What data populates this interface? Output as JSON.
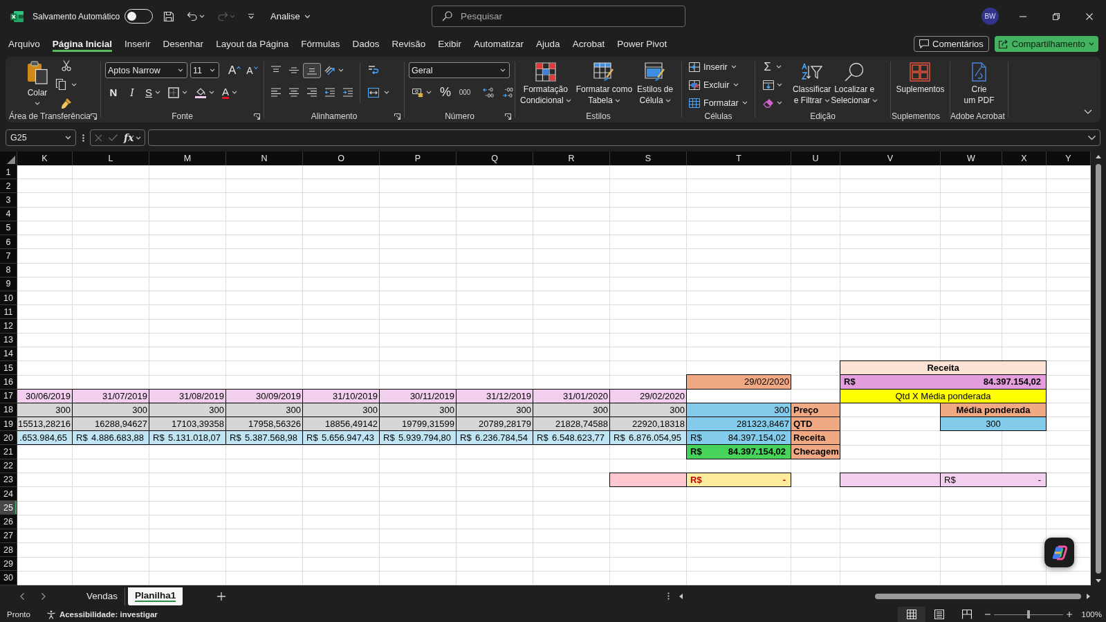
{
  "title_bar": {
    "autosave_label": "Salvamento Automático",
    "autosave_on": false,
    "quick_access": [
      {
        "kind": "save",
        "disabled": false
      },
      {
        "kind": "undo",
        "disabled": false
      },
      {
        "kind": "redo",
        "disabled": true
      },
      {
        "kind": "customize",
        "disabled": false
      }
    ],
    "file_name": "Analise",
    "search": {
      "placeholder": "Pesquisar"
    },
    "user_initials": "BW"
  },
  "menu_tabs": [
    {
      "label": "Arquivo",
      "selected": false
    },
    {
      "label": "Página Inicial",
      "selected": true
    },
    {
      "label": "Inserir",
      "selected": false
    },
    {
      "label": "Desenhar",
      "selected": false
    },
    {
      "label": "Layout da Página",
      "selected": false
    },
    {
      "label": "Fórmulas",
      "selected": false
    },
    {
      "label": "Dados",
      "selected": false
    },
    {
      "label": "Revisão",
      "selected": false
    },
    {
      "label": "Exibir",
      "selected": false
    },
    {
      "label": "Automatizar",
      "selected": false
    },
    {
      "label": "Ajuda",
      "selected": false
    },
    {
      "label": "Acrobat",
      "selected": false
    },
    {
      "label": "Power Pivot",
      "selected": false
    }
  ],
  "comments_button": "Comentários",
  "share_button": "Compartilhamento",
  "ribbon": {
    "clipboard": {
      "paste_label": "Colar",
      "group_label": "Área de Transferência"
    },
    "font": {
      "font_name": "Aptos Narrow",
      "font_size": "11",
      "grow_letter": "A",
      "shrink_letter": "A",
      "bold_letter": "N",
      "italic_letter": "I",
      "underline_letter": "S",
      "color_letter": "A",
      "group_label": "Fonte"
    },
    "alignment": {
      "vertical": [
        {
          "kind": "top",
          "selected": false
        },
        {
          "kind": "middle",
          "selected": false
        },
        {
          "kind": "bottom",
          "selected": true
        }
      ],
      "horizontal": [
        {
          "kind": "left",
          "selected": false
        },
        {
          "kind": "center",
          "selected": false
        },
        {
          "kind": "right",
          "selected": false
        }
      ],
      "group_label": "Alinhamento"
    },
    "number": {
      "format": "Geral",
      "percent_sign": "%",
      "thousands_sign": "000",
      "group_label": "Número"
    },
    "styles": {
      "buttons": [
        {
          "kind": "conditional",
          "label": "Formatação\nCondicional"
        },
        {
          "kind": "table",
          "label": "Formatar como\nTabela"
        },
        {
          "kind": "cell_styles",
          "label": "Estilos de\nCélula"
        }
      ],
      "group_label": "Estilos"
    },
    "cells": {
      "buttons": [
        {
          "kind": "insert",
          "label": "Inserir"
        },
        {
          "kind": "delete",
          "label": "Excluir"
        },
        {
          "kind": "format",
          "label": "Formatar"
        }
      ],
      "group_label": "Células"
    },
    "editing": {
      "sum_sign": "Σ",
      "buttons": [
        {
          "kind": "sort",
          "label": "Classificar\ne Filtrar"
        },
        {
          "kind": "find",
          "label": "Localizar e\nSelecionar"
        }
      ],
      "group_label": "Edição"
    },
    "addins": {
      "label": "Suplementos",
      "group_label": "Suplementos"
    },
    "acrobat": {
      "label": "Crie\num PDF",
      "group_label": "Adobe Acrobat"
    }
  },
  "formula_bar": {
    "name_box": "G25",
    "entry_disabled": true,
    "function_sign": "fx"
  },
  "sheet": {
    "columns": [
      "K",
      "L",
      "M",
      "N",
      "O",
      "P",
      "Q",
      "R",
      "S",
      "T",
      "U",
      "V",
      "W",
      "X",
      "Y"
    ],
    "rows": [
      {
        "label": "1",
        "selected": false
      },
      {
        "label": "2",
        "selected": false
      },
      {
        "label": "3",
        "selected": false
      },
      {
        "label": "4",
        "selected": false
      },
      {
        "label": "5",
        "selected": false
      },
      {
        "label": "6",
        "selected": false
      },
      {
        "label": "7",
        "selected": false
      },
      {
        "label": "8",
        "selected": false
      },
      {
        "label": "9",
        "selected": false
      },
      {
        "label": "10",
        "selected": false
      },
      {
        "label": "11",
        "selected": false
      },
      {
        "label": "12",
        "selected": false
      },
      {
        "label": "13",
        "selected": false
      },
      {
        "label": "14",
        "selected": false
      },
      {
        "label": "15",
        "selected": false,
        "cells": [
          {
            "kind": "empty"
          },
          {
            "kind": "empty"
          },
          {
            "kind": "empty"
          },
          {
            "kind": "empty"
          },
          {
            "kind": "empty"
          },
          {
            "kind": "empty"
          },
          {
            "kind": "empty"
          },
          {
            "kind": "empty"
          },
          {
            "kind": "empty"
          },
          {
            "kind": "empty"
          },
          {
            "kind": "empty"
          },
          {
            "kind": "centered",
            "text": "Receita",
            "bold": true,
            "alert": false,
            "color": "#fbe2d5"
          },
          {
            "kind": "merged"
          },
          {
            "kind": "merged"
          },
          {
            "kind": "empty"
          }
        ]
      },
      {
        "label": "16",
        "selected": false,
        "cells": [
          {
            "kind": "empty"
          },
          {
            "kind": "empty"
          },
          {
            "kind": "empty"
          },
          {
            "kind": "empty"
          },
          {
            "kind": "empty"
          },
          {
            "kind": "empty"
          },
          {
            "kind": "empty"
          },
          {
            "kind": "empty"
          },
          {
            "kind": "empty"
          },
          {
            "kind": "number",
            "text": "29/02/2020",
            "bold": false,
            "alert": false,
            "color": "#f1a983"
          },
          {
            "kind": "empty"
          },
          {
            "kind": "currency",
            "prefix": "R$",
            "text": "84.397.154,02",
            "bold": true,
            "alert": false,
            "color": "#e59edd"
          },
          {
            "kind": "merged"
          },
          {
            "kind": "merged"
          },
          {
            "kind": "empty"
          }
        ]
      },
      {
        "label": "17",
        "selected": false,
        "cells": [
          {
            "kind": "number",
            "text": "30/06/2019",
            "bold": false,
            "alert": false,
            "color": "#f2ceef"
          },
          {
            "kind": "number",
            "text": "31/07/2019",
            "bold": false,
            "alert": false,
            "color": "#f2ceef"
          },
          {
            "kind": "number",
            "text": "31/08/2019",
            "bold": false,
            "alert": false,
            "color": "#f2ceef"
          },
          {
            "kind": "number",
            "text": "30/09/2019",
            "bold": false,
            "alert": false,
            "color": "#f2ceef"
          },
          {
            "kind": "number",
            "text": "31/10/2019",
            "bold": false,
            "alert": false,
            "color": "#f2ceef"
          },
          {
            "kind": "number",
            "text": "30/11/2019",
            "bold": false,
            "alert": false,
            "color": "#f2ceef"
          },
          {
            "kind": "number",
            "text": "31/12/2019",
            "bold": false,
            "alert": false,
            "color": "#f2ceef"
          },
          {
            "kind": "number",
            "text": "31/01/2020",
            "bold": false,
            "alert": false,
            "color": "#f2ceef"
          },
          {
            "kind": "number",
            "text": "29/02/2020",
            "bold": false,
            "alert": false,
            "color": "#f2ceef"
          },
          {
            "kind": "empty"
          },
          {
            "kind": "empty"
          },
          {
            "kind": "centered",
            "text": "Qtd X Média ponderada",
            "bold": false,
            "alert": false,
            "color": "#ffff00"
          },
          {
            "kind": "merged"
          },
          {
            "kind": "merged"
          },
          {
            "kind": "empty"
          }
        ]
      },
      {
        "label": "18",
        "selected": false,
        "cells": [
          {
            "kind": "number",
            "text": "300",
            "bold": false,
            "alert": false,
            "color": "#d6d6d6"
          },
          {
            "kind": "number",
            "text": "300",
            "bold": false,
            "alert": false,
            "color": "#d6d6d6"
          },
          {
            "kind": "number",
            "text": "300",
            "bold": false,
            "alert": false,
            "color": "#d6d6d6"
          },
          {
            "kind": "number",
            "text": "300",
            "bold": false,
            "alert": false,
            "color": "#d6d6d6"
          },
          {
            "kind": "number",
            "text": "300",
            "bold": false,
            "alert": false,
            "color": "#d6d6d6"
          },
          {
            "kind": "number",
            "text": "300",
            "bold": false,
            "alert": false,
            "color": "#d6d6d6"
          },
          {
            "kind": "number",
            "text": "300",
            "bold": false,
            "alert": false,
            "color": "#d6d6d6"
          },
          {
            "kind": "number",
            "text": "300",
            "bold": false,
            "alert": false,
            "color": "#d6d6d6"
          },
          {
            "kind": "number",
            "text": "300",
            "bold": false,
            "alert": false,
            "color": "#d6d6d6"
          },
          {
            "kind": "number",
            "text": "300",
            "bold": false,
            "alert": false,
            "color": "#83cceb"
          },
          {
            "kind": "text",
            "text": "Preço",
            "bold": true,
            "alert": false,
            "color": "#f1a983"
          },
          {
            "kind": "empty"
          },
          {
            "kind": "centered",
            "text": "Média ponderada",
            "bold": true,
            "alert": false,
            "color": "#f1a983"
          },
          {
            "kind": "merged"
          },
          {
            "kind": "empty"
          }
        ]
      },
      {
        "label": "19",
        "selected": false,
        "cells": [
          {
            "kind": "number",
            "text": "15513,28216",
            "bold": false,
            "alert": false,
            "color": "#d6d6d6"
          },
          {
            "kind": "number",
            "text": "16288,94627",
            "bold": false,
            "alert": false,
            "color": "#d6d6d6"
          },
          {
            "kind": "number",
            "text": "17103,39358",
            "bold": false,
            "alert": false,
            "color": "#d6d6d6"
          },
          {
            "kind": "number",
            "text": "17958,56326",
            "bold": false,
            "alert": false,
            "color": "#d6d6d6"
          },
          {
            "kind": "number",
            "text": "18856,49142",
            "bold": false,
            "alert": false,
            "color": "#d6d6d6"
          },
          {
            "kind": "number",
            "text": "19799,31599",
            "bold": false,
            "alert": false,
            "color": "#d6d6d6"
          },
          {
            "kind": "number",
            "text": "20789,28179",
            "bold": false,
            "alert": false,
            "color": "#d6d6d6"
          },
          {
            "kind": "number",
            "text": "21828,74588",
            "bold": false,
            "alert": false,
            "color": "#d6d6d6"
          },
          {
            "kind": "number",
            "text": "22920,18318",
            "bold": false,
            "alert": false,
            "color": "#d6d6d6"
          },
          {
            "kind": "number",
            "text": "281323,8467",
            "bold": false,
            "alert": false,
            "color": "#83cceb"
          },
          {
            "kind": "text",
            "text": "QTD",
            "bold": true,
            "alert": false,
            "color": "#f1a983"
          },
          {
            "kind": "empty"
          },
          {
            "kind": "centered",
            "text": "300",
            "bold": false,
            "alert": false,
            "color": "#83cceb"
          },
          {
            "kind": "merged"
          },
          {
            "kind": "empty"
          }
        ]
      },
      {
        "label": "20",
        "selected": false,
        "cells": [
          {
            "kind": "currency",
            "text": ".653.984,65",
            "bold": false,
            "alert": false,
            "color": "#c0e6f5"
          },
          {
            "kind": "currency",
            "prefix": "R$",
            "text": "4.886.683,88",
            "bold": false,
            "alert": false,
            "color": "#c0e6f5"
          },
          {
            "kind": "currency",
            "prefix": "R$",
            "text": "5.131.018,07",
            "bold": false,
            "alert": false,
            "color": "#c0e6f5"
          },
          {
            "kind": "currency",
            "prefix": "R$",
            "text": "5.387.568,98",
            "bold": false,
            "alert": false,
            "color": "#c0e6f5"
          },
          {
            "kind": "currency",
            "prefix": "R$",
            "text": "5.656.947,43",
            "bold": false,
            "alert": false,
            "color": "#c0e6f5"
          },
          {
            "kind": "currency",
            "prefix": "R$",
            "text": "5.939.794,80",
            "bold": false,
            "alert": false,
            "color": "#c0e6f5"
          },
          {
            "kind": "currency",
            "prefix": "R$",
            "text": "6.236.784,54",
            "bold": false,
            "alert": false,
            "color": "#c0e6f5"
          },
          {
            "kind": "currency",
            "prefix": "R$",
            "text": "6.548.623,77",
            "bold": false,
            "alert": false,
            "color": "#c0e6f5"
          },
          {
            "kind": "currency",
            "prefix": "R$",
            "text": "6.876.054,95",
            "bold": false,
            "alert": false,
            "color": "#c0e6f5"
          },
          {
            "kind": "currency",
            "prefix": "R$",
            "text": "84.397.154,02",
            "bold": false,
            "alert": false,
            "color": "#83cceb"
          },
          {
            "kind": "text",
            "text": "Receita",
            "bold": true,
            "alert": false,
            "color": "#f1a983"
          },
          {
            "kind": "empty"
          },
          {
            "kind": "empty"
          },
          {
            "kind": "empty"
          },
          {
            "kind": "empty"
          }
        ]
      },
      {
        "label": "21",
        "selected": false,
        "cells": [
          {
            "kind": "empty"
          },
          {
            "kind": "empty"
          },
          {
            "kind": "empty"
          },
          {
            "kind": "empty"
          },
          {
            "kind": "empty"
          },
          {
            "kind": "empty"
          },
          {
            "kind": "empty"
          },
          {
            "kind": "empty"
          },
          {
            "kind": "empty"
          },
          {
            "kind": "currency",
            "prefix": "R$",
            "text": "84.397.154,02",
            "bold": true,
            "alert": false,
            "color": "#47d359"
          },
          {
            "kind": "text",
            "text": "Checagem",
            "bold": true,
            "alert": false,
            "color": "#f1a983"
          },
          {
            "kind": "empty"
          },
          {
            "kind": "empty"
          },
          {
            "kind": "empty"
          },
          {
            "kind": "empty"
          }
        ]
      },
      {
        "label": "22",
        "selected": false
      },
      {
        "label": "23",
        "selected": false,
        "cells": [
          {
            "kind": "empty"
          },
          {
            "kind": "empty"
          },
          {
            "kind": "empty"
          },
          {
            "kind": "empty"
          },
          {
            "kind": "empty"
          },
          {
            "kind": "empty"
          },
          {
            "kind": "empty"
          },
          {
            "kind": "empty"
          },
          {
            "kind": "text",
            "color": "#ffc7ce"
          },
          {
            "kind": "currency",
            "prefix": "R$",
            "text": "-",
            "bold": true,
            "alert": true,
            "color": "#ffeb9c"
          },
          {
            "kind": "empty"
          },
          {
            "kind": "text",
            "color": "#f2ceef"
          },
          {
            "kind": "currency",
            "prefix": "R$",
            "text": "-",
            "bold": false,
            "alert": false,
            "color": "#f2ceef"
          },
          {
            "kind": "merged"
          },
          {
            "kind": "empty"
          }
        ]
      },
      {
        "label": "24",
        "selected": false
      },
      {
        "label": "25",
        "selected": true
      },
      {
        "label": "26",
        "selected": false
      },
      {
        "label": "27",
        "selected": false
      },
      {
        "label": "28",
        "selected": false
      },
      {
        "label": "29",
        "selected": false
      },
      {
        "label": "30",
        "selected": false
      }
    ]
  },
  "sheet_tabs": [
    {
      "label": "Vendas",
      "selected": false
    },
    {
      "label": "Planilha1",
      "selected": true
    }
  ],
  "status_bar": {
    "status": "Pronto",
    "accessibility": "Acessibilidade: investigar",
    "views": [
      {
        "kind": "normal",
        "selected": true
      },
      {
        "kind": "page_layout",
        "selected": false
      },
      {
        "kind": "page_break",
        "selected": false
      }
    ],
    "zoom": {
      "level": 0.5,
      "reading": "100%"
    }
  }
}
